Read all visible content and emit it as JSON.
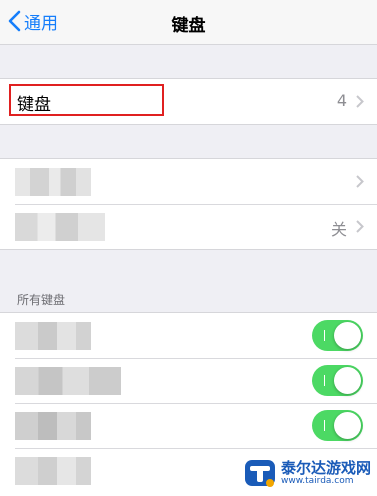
{
  "navbar": {
    "back_label": "通用",
    "title": "键盘"
  },
  "keyboard_row": {
    "label": "键盘",
    "count": "4"
  },
  "settings_rows": [
    {
      "value": ""
    },
    {
      "value": "关"
    }
  ],
  "all_keyboards": {
    "header": "所有键盘",
    "toggles": [
      true,
      true,
      true
    ]
  },
  "watermark": {
    "text": "泰尔达游戏网",
    "url": "www.tairda.com"
  },
  "colors": {
    "accent": "#157efb",
    "toggle_on": "#4cd964",
    "highlight": "#e02020",
    "background": "#efeff4"
  }
}
